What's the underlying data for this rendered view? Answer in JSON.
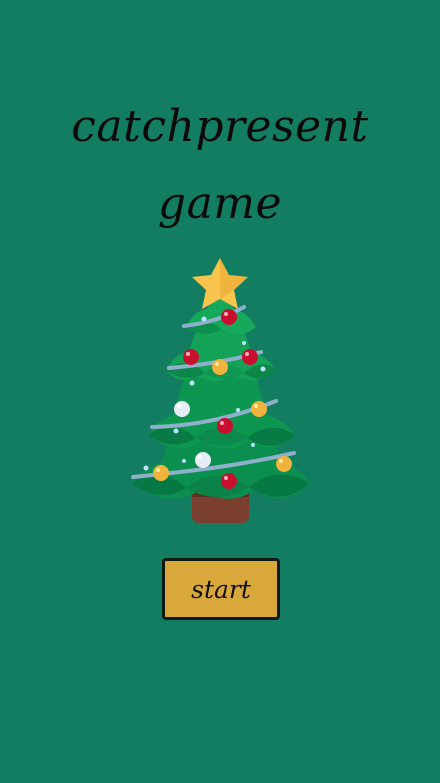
{
  "game": {
    "title_line_1": "catchpresent",
    "title_line_2": "game",
    "start_label": "start",
    "colors": {
      "background": "#127d61",
      "button": "#d9a83b",
      "button_border": "#111a14",
      "text": "#0a0a0a"
    },
    "icons": [
      "christmas-tree-icon",
      "star-icon"
    ]
  }
}
